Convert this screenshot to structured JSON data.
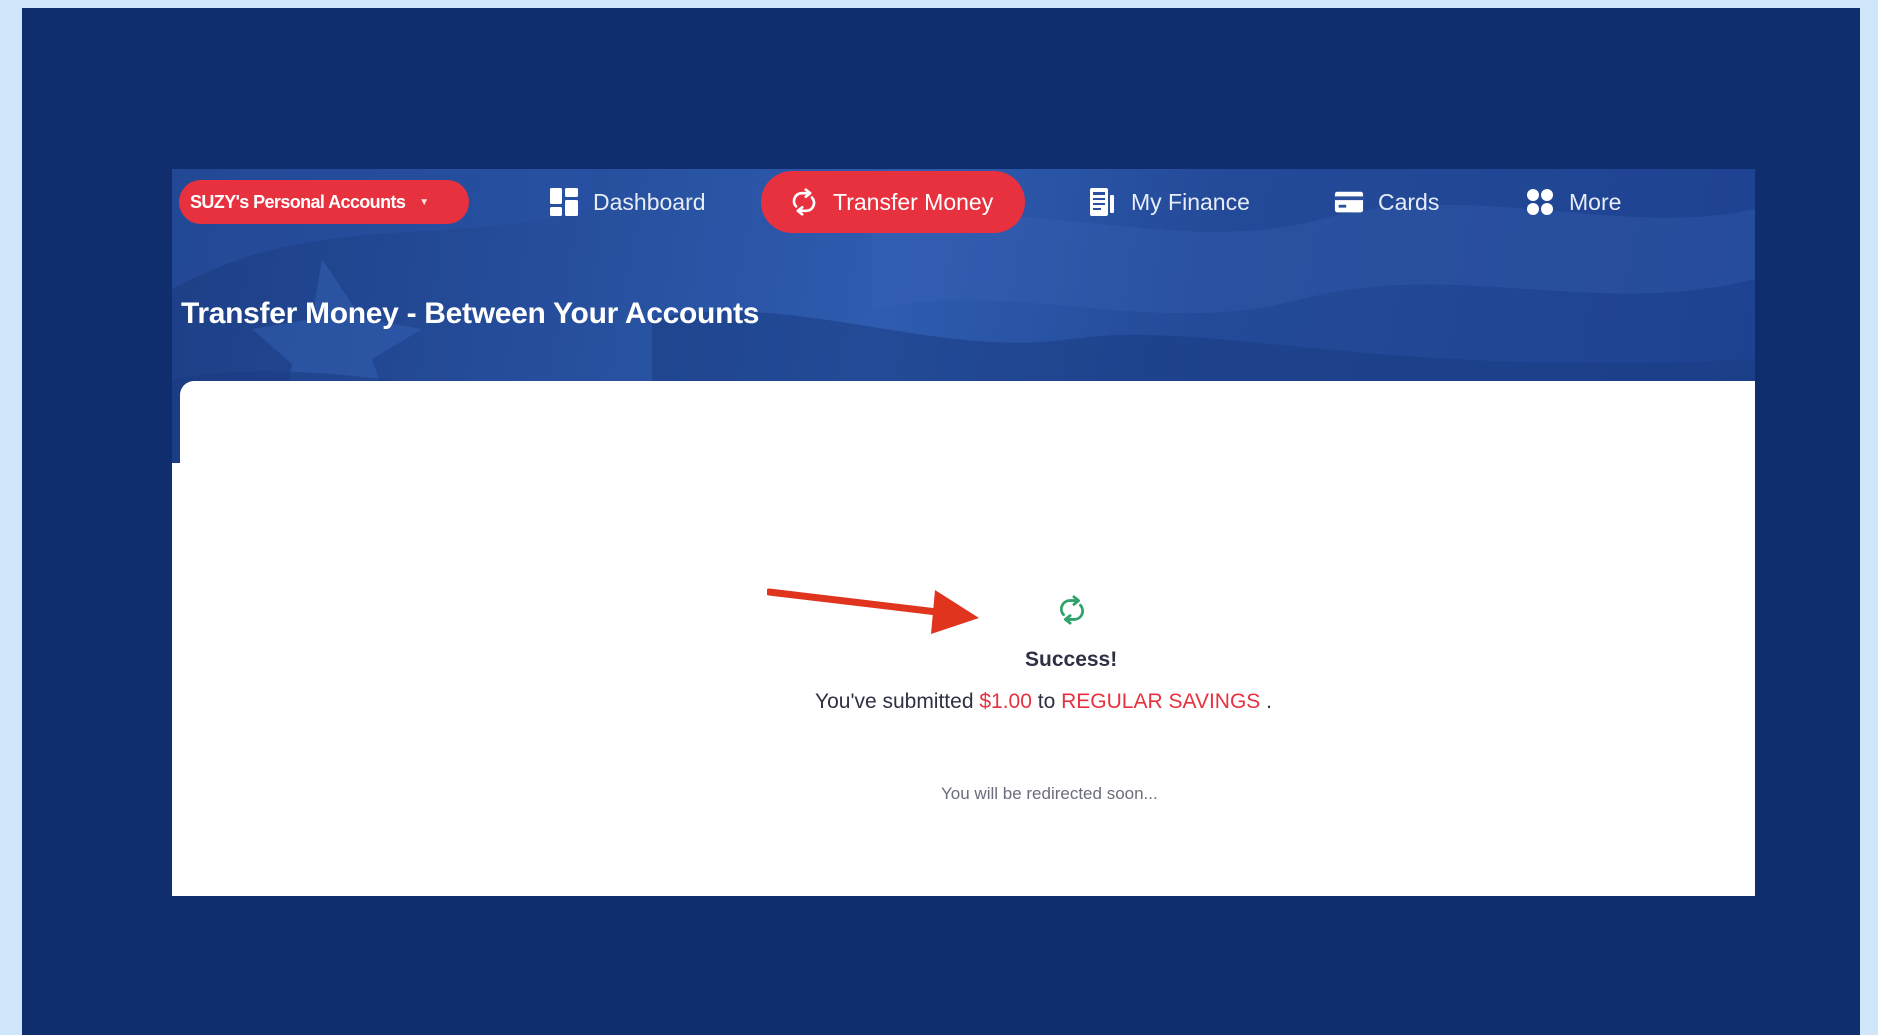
{
  "nav": {
    "account_selector": "SUZY's Personal Accounts",
    "items": [
      {
        "label": "Dashboard",
        "icon": "dashboard-icon"
      },
      {
        "label": "Transfer Money",
        "icon": "transfer-icon"
      },
      {
        "label": "My Finance",
        "icon": "finance-icon"
      },
      {
        "label": "Cards",
        "icon": "card-icon"
      },
      {
        "label": "More",
        "icon": "more-icon"
      }
    ],
    "active_item": "Transfer Money"
  },
  "page": {
    "title": "Transfer Money - Between Your Accounts"
  },
  "result": {
    "icon": "transfer-success-icon",
    "heading": "Success!",
    "message_prefix": "You've submitted",
    "amount": "$1.00",
    "message_middle": "to",
    "destination": "REGULAR SAVINGS",
    "message_suffix": ".",
    "redirect_note": "You will be redirected soon..."
  },
  "annotation": {
    "icon": "red-arrow-annotation"
  },
  "colors": {
    "accent": "#e8313f",
    "navy_background": "#102e6d",
    "outer_background": "#cfe6fb",
    "success_green": "#2fa36b"
  }
}
